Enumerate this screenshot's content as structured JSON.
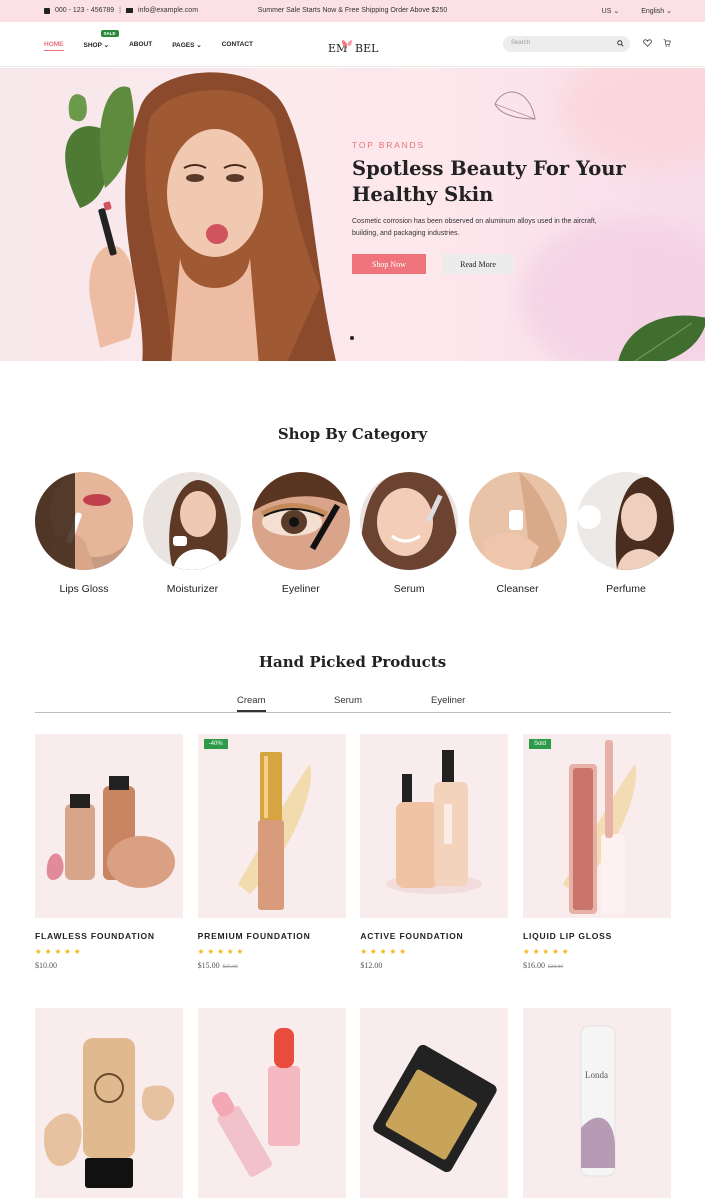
{
  "topbar": {
    "phone": "000 - 123 - 456789",
    "email": "info@example.com",
    "announcement": "Summer Sale Starts Now & Free Shipping Order Above $250",
    "currency": "US",
    "language": "English"
  },
  "nav": {
    "items": [
      {
        "label": "HOME"
      },
      {
        "label": "SHOP"
      },
      {
        "label": "ABOUT"
      },
      {
        "label": "PAGES"
      },
      {
        "label": "CONTACT"
      }
    ],
    "sale_badge": "SALE"
  },
  "logo": {
    "left": "EM",
    "right": "BEL"
  },
  "search": {
    "placeholder": "Search"
  },
  "hero": {
    "eyebrow": "TOP BRANDS",
    "title": "Spotless Beauty For Your Healthy Skin",
    "description": "Cosmetic corrosion has been observed on aluminum alloys used in the aircraft, building, and packaging industries.",
    "primary_btn": "Shop Now",
    "secondary_btn": "Read More"
  },
  "categories": {
    "title": "Shop By Category",
    "items": [
      {
        "label": "Lips Gloss"
      },
      {
        "label": "Moisturizer"
      },
      {
        "label": "Eyeliner"
      },
      {
        "label": "Serum"
      },
      {
        "label": "Cleanser"
      },
      {
        "label": "Perfume"
      }
    ]
  },
  "products": {
    "title": "Hand Picked Products",
    "tabs": [
      {
        "label": "Cream"
      },
      {
        "label": "Serum"
      },
      {
        "label": "Eyeliner"
      }
    ],
    "items": [
      {
        "name": "FLAWLESS FOUNDATION",
        "price": "$10.00",
        "old_price": "",
        "badge": "",
        "rating": 5
      },
      {
        "name": "PREMIUM FOUNDATION",
        "price": "$15.00",
        "old_price": "$25.00",
        "badge": "-40%",
        "rating": 5
      },
      {
        "name": "ACTIVE FOUNDATION",
        "price": "$12.00",
        "old_price": "",
        "badge": "",
        "rating": 5
      },
      {
        "name": "LIQUID LIP GLOSS",
        "price": "$16.00",
        "old_price": "$20.00",
        "badge": "Sold",
        "rating": 5
      }
    ],
    "stars": "★★★★★"
  },
  "colors": {
    "accent": "#ef747c",
    "topbar_bg": "#fbe1e6",
    "badge_green": "#2c9a48",
    "star": "#f4b516",
    "product_bg": "#f9eced"
  }
}
